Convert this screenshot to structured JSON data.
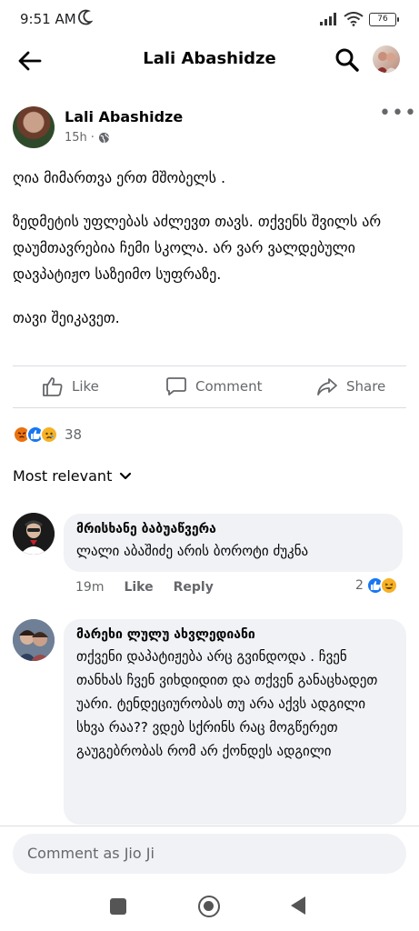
{
  "status_bar": {
    "time": "9:51 AM",
    "battery": "76"
  },
  "app_bar": {
    "title": "Lali Abashidze"
  },
  "post": {
    "author": "Lali Abashidze",
    "time": "15h",
    "paragraphs": [
      "ღია მიმართვა ერთ მშობელს .",
      "ზედმეტის უფლებას აძლევთ თავს. თქვენს შვილს არ დაუმთავრებია ჩემი სკოლა. არ ვარ ვალდებული დავპატიჟო საზეიმო სუფრაზე.",
      "თავი შეიკავეთ."
    ],
    "actions": {
      "like": "Like",
      "comment": "Comment",
      "share": "Share"
    },
    "reactions": {
      "icons": [
        "angry-react-icon",
        "like-react-icon",
        "sad-react-icon"
      ],
      "count": "38"
    }
  },
  "comments_filter": "Most relevant",
  "comments": [
    {
      "name": "მრისხანე ბაბუაწვერა",
      "text": "ლალი აბაშიძე არის ბოროტი ძუკნა",
      "time": "19m",
      "like_label": "Like",
      "reply_label": "Reply",
      "reaction_count": "2"
    },
    {
      "name": "მარეხი ლულუ ახვლედიანი",
      "text": "თქვენი დაპატიჟება არც გვინდოდა . ჩვენ თანხას ჩვენ ვიხდიდით და თქვენ განაცხადეთ უარი. ტენდეციურობას თუ არა აქვს ადგილი სხვა რაა?? ვდებ სქრინს რაც მოგწერეთ გაუგებრობას რომ არ ქონდეს ადგილი"
    }
  ],
  "composer": {
    "placeholder": "Comment as Jio Ji"
  },
  "colors": {
    "accent": "#1877f2",
    "secondary_text": "#65676b",
    "bubble": "#f0f2f5"
  }
}
